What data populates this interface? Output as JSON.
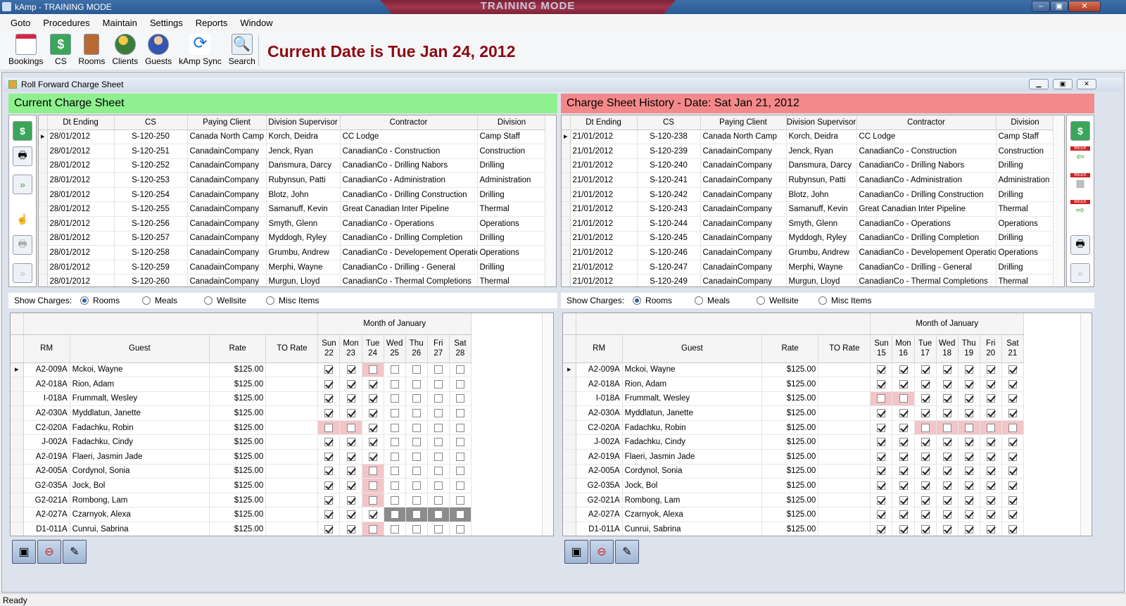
{
  "window": {
    "title": "kAmp - TRAINING MODE",
    "banner": "TRAINING MODE",
    "min": "‒",
    "max": "▣",
    "close": "✕"
  },
  "menu": [
    "Goto",
    "Procedures",
    "Maintain",
    "Settings",
    "Reports",
    "Window"
  ],
  "toolbar": {
    "buttons": [
      {
        "label": "Bookings",
        "icon": "calendar-icon"
      },
      {
        "label": "CS",
        "icon": "dollar-sheet-icon"
      },
      {
        "label": "Rooms",
        "icon": "door-icon"
      },
      {
        "label": "Clients",
        "icon": "clients-icon"
      },
      {
        "label": "Guests",
        "icon": "guests-icon"
      },
      {
        "label": "kAmp Sync",
        "icon": "sync-icon"
      },
      {
        "label": "Search",
        "icon": "search-icon"
      }
    ],
    "current_date": "Current Date is Tue Jan 24, 2012"
  },
  "child_window": {
    "title": "Roll Forward Charge Sheet"
  },
  "left": {
    "header": "Current Charge Sheet",
    "columns": [
      "Dt Ending",
      "CS",
      "Paying Client",
      "Division Supervisor",
      "Contractor",
      "Division"
    ],
    "rows": [
      [
        "28/01/2012",
        "S-120-250",
        "Canada North Camp",
        "Korch, Deidra",
        "CC Lodge",
        "Camp Staff"
      ],
      [
        "28/01/2012",
        "S-120-251",
        "CanadainCompany",
        "Jenck, Ryan",
        "CanadianCo - Construction",
        "Construction"
      ],
      [
        "28/01/2012",
        "S-120-252",
        "CanadainCompany",
        "Dansmura, Darcy",
        "CanadianCo - Drilling Nabors",
        "Drilling"
      ],
      [
        "28/01/2012",
        "S-120-253",
        "CanadainCompany",
        "Rubynsun, Patti",
        "CanadianCo - Administration",
        "Administration"
      ],
      [
        "28/01/2012",
        "S-120-254",
        "CanadainCompany",
        "Blotz, John",
        "CanadianCo - Drilling Construction",
        "Drilling"
      ],
      [
        "28/01/2012",
        "S-120-255",
        "CanadainCompany",
        "Samanuff, Kevin",
        "Great Canadian Inter Pipeline",
        "Thermal"
      ],
      [
        "28/01/2012",
        "S-120-256",
        "CanadainCompany",
        "Smyth, Glenn",
        "CanadianCo - Operations",
        "Operations"
      ],
      [
        "28/01/2012",
        "S-120-257",
        "CanadainCompany",
        "Myddogh, Ryley",
        "CanadianCo - Drilling Completion",
        "Drilling"
      ],
      [
        "28/01/2012",
        "S-120-258",
        "CanadainCompany",
        "Grumbu, Andrew",
        "CanadianCo - Developement Operations",
        "Operations"
      ],
      [
        "28/01/2012",
        "S-120-259",
        "CanadainCompany",
        "Merphi, Wayne",
        "CanadianCo - Drilling - General",
        "Drilling"
      ],
      [
        "28/01/2012",
        "S-120-260",
        "CanadainCompany",
        "Murgun, Lloyd",
        "CanadianCo - Thermal Completions",
        "Thermal"
      ]
    ],
    "show_charges": {
      "label": "Show Charges:",
      "options": [
        "Rooms",
        "Meals",
        "Wellsite",
        "Misc Items"
      ],
      "selected": 0
    },
    "month": "Month of January",
    "charge_columns": [
      "RM",
      "Guest",
      "Rate",
      "TO Rate"
    ],
    "days": [
      [
        "Sun",
        "22"
      ],
      [
        "Mon",
        "23"
      ],
      [
        "Tue",
        "24"
      ],
      [
        "Wed",
        "25"
      ],
      [
        "Thu",
        "26"
      ],
      [
        "Fri",
        "27"
      ],
      [
        "Sat",
        "28"
      ]
    ],
    "charges": [
      {
        "rm": "A2-009A",
        "guest": "Mckoi, Wayne",
        "rate": "$125.00",
        "checks": [
          1,
          1,
          0,
          0,
          0,
          0,
          0
        ],
        "bg": [
          "",
          "",
          "p",
          "",
          "",
          "",
          ""
        ]
      },
      {
        "rm": "A2-018A",
        "guest": "Rion, Adam",
        "rate": "$125.00",
        "checks": [
          1,
          1,
          1,
          0,
          0,
          0,
          0
        ],
        "bg": [
          "",
          "",
          "",
          "",
          "",
          "",
          ""
        ]
      },
      {
        "rm": "I-018A",
        "guest": "Frummalt, Wesley",
        "rate": "$125.00",
        "checks": [
          1,
          1,
          1,
          0,
          0,
          0,
          0
        ],
        "bg": [
          "",
          "",
          "",
          "",
          "",
          "",
          ""
        ]
      },
      {
        "rm": "A2-030A",
        "guest": "Myddlatun, Janette",
        "rate": "$125.00",
        "checks": [
          1,
          1,
          1,
          0,
          0,
          0,
          0
        ],
        "bg": [
          "",
          "",
          "",
          "",
          "",
          "",
          ""
        ]
      },
      {
        "rm": "C2-020A",
        "guest": "Fadachku, Robin",
        "rate": "$125.00",
        "checks": [
          0,
          0,
          1,
          0,
          0,
          0,
          0
        ],
        "bg": [
          "p",
          "p",
          "",
          "",
          "",
          "",
          ""
        ]
      },
      {
        "rm": "J-002A",
        "guest": "Fadachku, Cindy",
        "rate": "$125.00",
        "checks": [
          1,
          1,
          1,
          0,
          0,
          0,
          0
        ],
        "bg": [
          "",
          "",
          "",
          "",
          "",
          "",
          ""
        ]
      },
      {
        "rm": "A2-019A",
        "guest": "Flaeri, Jasmin Jade",
        "rate": "$125.00",
        "checks": [
          1,
          1,
          1,
          0,
          0,
          0,
          0
        ],
        "bg": [
          "",
          "",
          "",
          "",
          "",
          "",
          ""
        ]
      },
      {
        "rm": "A2-005A",
        "guest": "Cordynol, Sonia",
        "rate": "$125.00",
        "checks": [
          1,
          1,
          0,
          0,
          0,
          0,
          0
        ],
        "bg": [
          "",
          "",
          "p",
          "",
          "",
          "",
          ""
        ]
      },
      {
        "rm": "G2-035A",
        "guest": "Jock, Bol",
        "rate": "$125.00",
        "checks": [
          1,
          1,
          0,
          0,
          0,
          0,
          0
        ],
        "bg": [
          "",
          "",
          "p",
          "",
          "",
          "",
          ""
        ]
      },
      {
        "rm": "G2-021A",
        "guest": "Rombong, Lam",
        "rate": "$125.00",
        "checks": [
          1,
          1,
          0,
          0,
          0,
          0,
          0
        ],
        "bg": [
          "",
          "",
          "p",
          "",
          "",
          "",
          ""
        ]
      },
      {
        "rm": "A2-027A",
        "guest": "Czarnyok, Alexa",
        "rate": "$125.00",
        "checks": [
          1,
          1,
          1,
          0,
          0,
          0,
          0
        ],
        "bg": [
          "",
          "",
          "",
          "d",
          "d",
          "d",
          "d"
        ]
      },
      {
        "rm": "D1-011A",
        "guest": "Cunrui, Sabrina",
        "rate": "$125.00",
        "checks": [
          1,
          1,
          0,
          0,
          0,
          0,
          0
        ],
        "bg": [
          "",
          "",
          "p",
          "",
          "",
          "",
          ""
        ]
      }
    ]
  },
  "right": {
    "header": "Charge Sheet History - Date: Sat Jan 21, 2012",
    "columns": [
      "Dt Ending",
      "CS",
      "Paying Client",
      "Division Supervisor",
      "Contractor",
      "Division"
    ],
    "rows": [
      [
        "21/01/2012",
        "S-120-238",
        "Canada North Camp",
        "Korch, Deidra",
        "CC Lodge",
        "Camp Staff"
      ],
      [
        "21/01/2012",
        "S-120-239",
        "CanadainCompany",
        "Jenck, Ryan",
        "CanadianCo - Construction",
        "Construction"
      ],
      [
        "21/01/2012",
        "S-120-240",
        "CanadainCompany",
        "Dansmura, Darcy",
        "CanadianCo - Drilling Nabors",
        "Drilling"
      ],
      [
        "21/01/2012",
        "S-120-241",
        "CanadainCompany",
        "Rubynsun, Patti",
        "CanadianCo - Administration",
        "Administration"
      ],
      [
        "21/01/2012",
        "S-120-242",
        "CanadainCompany",
        "Blotz, John",
        "CanadianCo - Drilling Construction",
        "Drilling"
      ],
      [
        "21/01/2012",
        "S-120-243",
        "CanadainCompany",
        "Samanuff, Kevin",
        "Great Canadian Inter Pipeline",
        "Thermal"
      ],
      [
        "21/01/2012",
        "S-120-244",
        "CanadainCompany",
        "Smyth, Glenn",
        "CanadianCo - Operations",
        "Operations"
      ],
      [
        "21/01/2012",
        "S-120-245",
        "CanadainCompany",
        "Myddogh, Ryley",
        "CanadianCo - Drilling Completion",
        "Drilling"
      ],
      [
        "21/01/2012",
        "S-120-246",
        "CanadainCompany",
        "Grumbu, Andrew",
        "CanadianCo - Developement Operations",
        "Operations"
      ],
      [
        "21/01/2012",
        "S-120-247",
        "CanadainCompany",
        "Merphi, Wayne",
        "CanadianCo - Drilling - General",
        "Drilling"
      ],
      [
        "21/01/2012",
        "S-120-249",
        "CanadainCompany",
        "Murgun, Lloyd",
        "CanadianCo - Thermal Completions",
        "Thermal"
      ]
    ],
    "show_charges": {
      "label": "Show Charges:",
      "options": [
        "Rooms",
        "Meals",
        "Wellsite",
        "Misc Items"
      ],
      "selected": 0
    },
    "month": "Month of January",
    "charge_columns": [
      "RM",
      "Guest",
      "Rate",
      "TO Rate"
    ],
    "days": [
      [
        "Sun",
        "15"
      ],
      [
        "Mon",
        "16"
      ],
      [
        "Tue",
        "17"
      ],
      [
        "Wed",
        "18"
      ],
      [
        "Thu",
        "19"
      ],
      [
        "Fri",
        "20"
      ],
      [
        "Sat",
        "21"
      ]
    ],
    "charges": [
      {
        "rm": "A2-009A",
        "guest": "Mckoi, Wayne",
        "rate": "$125.00",
        "checks": [
          1,
          1,
          1,
          1,
          1,
          1,
          1
        ],
        "bg": [
          "",
          "",
          "",
          "",
          "",
          "",
          ""
        ]
      },
      {
        "rm": "A2-018A",
        "guest": "Rion, Adam",
        "rate": "$125.00",
        "checks": [
          1,
          1,
          1,
          1,
          1,
          1,
          1
        ],
        "bg": [
          "",
          "",
          "",
          "",
          "",
          "",
          ""
        ]
      },
      {
        "rm": "I-018A",
        "guest": "Frummalt, Wesley",
        "rate": "$125.00",
        "checks": [
          0,
          0,
          1,
          1,
          1,
          1,
          1
        ],
        "bg": [
          "p",
          "p",
          "",
          "",
          "",
          "",
          ""
        ]
      },
      {
        "rm": "A2-030A",
        "guest": "Myddlatun, Janette",
        "rate": "$125.00",
        "checks": [
          1,
          1,
          1,
          1,
          1,
          1,
          1
        ],
        "bg": [
          "",
          "",
          "",
          "",
          "",
          "",
          ""
        ]
      },
      {
        "rm": "C2-020A",
        "guest": "Fadachku, Robin",
        "rate": "$125.00",
        "checks": [
          1,
          1,
          0,
          0,
          0,
          0,
          0
        ],
        "bg": [
          "",
          "",
          "p",
          "p",
          "p",
          "p",
          "p"
        ]
      },
      {
        "rm": "J-002A",
        "guest": "Fadachku, Cindy",
        "rate": "$125.00",
        "checks": [
          1,
          1,
          1,
          1,
          1,
          1,
          1
        ],
        "bg": [
          "",
          "",
          "",
          "",
          "",
          "",
          ""
        ]
      },
      {
        "rm": "A2-019A",
        "guest": "Flaeri, Jasmin Jade",
        "rate": "$125.00",
        "checks": [
          1,
          1,
          1,
          1,
          1,
          1,
          1
        ],
        "bg": [
          "",
          "",
          "",
          "",
          "",
          "",
          ""
        ]
      },
      {
        "rm": "A2-005A",
        "guest": "Cordynol, Sonia",
        "rate": "$125.00",
        "checks": [
          1,
          1,
          1,
          1,
          1,
          1,
          1
        ],
        "bg": [
          "",
          "",
          "",
          "",
          "",
          "",
          ""
        ]
      },
      {
        "rm": "G2-035A",
        "guest": "Jock, Bol",
        "rate": "$125.00",
        "checks": [
          1,
          1,
          1,
          1,
          1,
          1,
          1
        ],
        "bg": [
          "",
          "",
          "",
          "",
          "",
          "",
          ""
        ]
      },
      {
        "rm": "G2-021A",
        "guest": "Rombong, Lam",
        "rate": "$125.00",
        "checks": [
          1,
          1,
          1,
          1,
          1,
          1,
          1
        ],
        "bg": [
          "",
          "",
          "",
          "",
          "",
          "",
          ""
        ]
      },
      {
        "rm": "A2-027A",
        "guest": "Czarnyok, Alexa",
        "rate": "$125.00",
        "checks": [
          1,
          1,
          1,
          1,
          1,
          1,
          1
        ],
        "bg": [
          "",
          "",
          "",
          "",
          "",
          "",
          ""
        ]
      },
      {
        "rm": "D1-011A",
        "guest": "Cunrui, Sabrina",
        "rate": "$125.00",
        "checks": [
          1,
          1,
          1,
          1,
          1,
          1,
          1
        ],
        "bg": [
          "",
          "",
          "",
          "",
          "",
          "",
          ""
        ]
      }
    ]
  },
  "side_icons": {
    "week_label": "WEEK"
  },
  "colors": {
    "current_header": "#8ef08e",
    "history_header": "#f4898b",
    "date_red": "#8b0b10"
  },
  "status": "Ready"
}
